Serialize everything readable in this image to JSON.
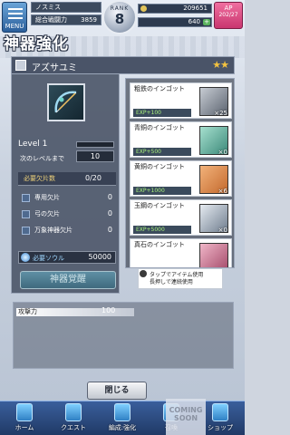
{
  "header": {
    "menu_label": "MENU",
    "player_name": "ノスミス",
    "power_label": "総合戦闘力",
    "power_value": "3859",
    "rank_label": "RANK",
    "rank_value": "8",
    "coins": "209651",
    "gems": "640",
    "ap_label": "AP",
    "ap_value": "202/27"
  },
  "page_title": "神器強化",
  "weapon": {
    "name": "アズサユミ",
    "stars": "★★",
    "level_label": "Level 1",
    "next_label": "次のレベルまで",
    "next_value": "10",
    "required_label": "必要欠片数",
    "required_value": "0/20",
    "fragments": [
      {
        "label": "専用欠片",
        "value": "0"
      },
      {
        "label": "弓の欠片",
        "value": "0"
      },
      {
        "label": "万象神器欠片",
        "value": "0"
      }
    ],
    "soul_label": "必要ソウル",
    "soul_value": "50000",
    "awaken_label": "神器覚醒"
  },
  "ingots": [
    {
      "name": "粗鉄のインゴット",
      "exp": "EXP+100",
      "count": "×25",
      "color": "#5c6470"
    },
    {
      "name": "青銅のインゴット",
      "exp": "EXP+500",
      "count": "×0",
      "color": "#3d8a7a"
    },
    {
      "name": "黄銅のインゴット",
      "exp": "EXP+1000",
      "count": "×6",
      "color": "#c46a2e"
    },
    {
      "name": "玉鋼のインゴット",
      "exp": "EXP+5000",
      "count": "×0",
      "color": "#6f7d8e"
    },
    {
      "name": "真石のインゴット",
      "exp": "",
      "count": "",
      "color": "#a44a6a"
    }
  ],
  "hint": {
    "line1": "タップでアイテム使用",
    "line2": "長押しで連続使用"
  },
  "stat": {
    "name": "攻撃力",
    "value": "100"
  },
  "close_label": "閉じる",
  "nav": [
    {
      "label": "ホーム"
    },
    {
      "label": "クエスト"
    },
    {
      "label": "編成:強化"
    },
    {
      "label": "召喚"
    },
    {
      "label": "ショップ"
    }
  ],
  "coming_soon": "COMING SOON"
}
